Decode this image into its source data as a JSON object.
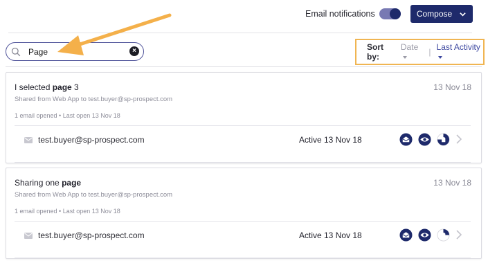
{
  "header": {
    "notifications_label": "Email notifications",
    "notifications_on": true,
    "compose_label": "Compose"
  },
  "search": {
    "value": "Page"
  },
  "sort": {
    "label": "Sort by:",
    "option_date": "Date",
    "separator": "|",
    "option_last_activity": "Last Activity",
    "selected": "Last Activity"
  },
  "colors": {
    "brand": "#1e2a6b",
    "highlight_box": "#f0b552",
    "annotation_arrow": "#f4b04a",
    "link": "#3d48a0"
  },
  "shares": [
    {
      "title_prefix": "I selected ",
      "title_bold": "page",
      "title_suffix": " 3",
      "date": "13 Nov 18",
      "shared_line": "Shared from Web App to test.buyer@sp-prospect.com",
      "opened_line": "1 email opened • Last open 13 Nov 18",
      "recipient": {
        "email": "test.buyer@sp-prospect.com",
        "activity": "Active 13 Nov 18",
        "icons": [
          "envelope-open-icon",
          "eye-icon",
          "document-progress-icon",
          "chevron-right-icon"
        ]
      }
    },
    {
      "title_prefix": "Sharing one ",
      "title_bold": "page",
      "title_suffix": "",
      "date": "13 Nov 18",
      "shared_line": "Shared from Web App to test.buyer@sp-prospect.com",
      "opened_line": "1 email opened • Last open 13 Nov 18",
      "recipient": {
        "email": "test.buyer@sp-prospect.com",
        "activity": "Active 13 Nov 18",
        "icons": [
          "envelope-open-icon",
          "eye-icon",
          "document-progress-icon",
          "chevron-right-icon"
        ]
      }
    }
  ]
}
